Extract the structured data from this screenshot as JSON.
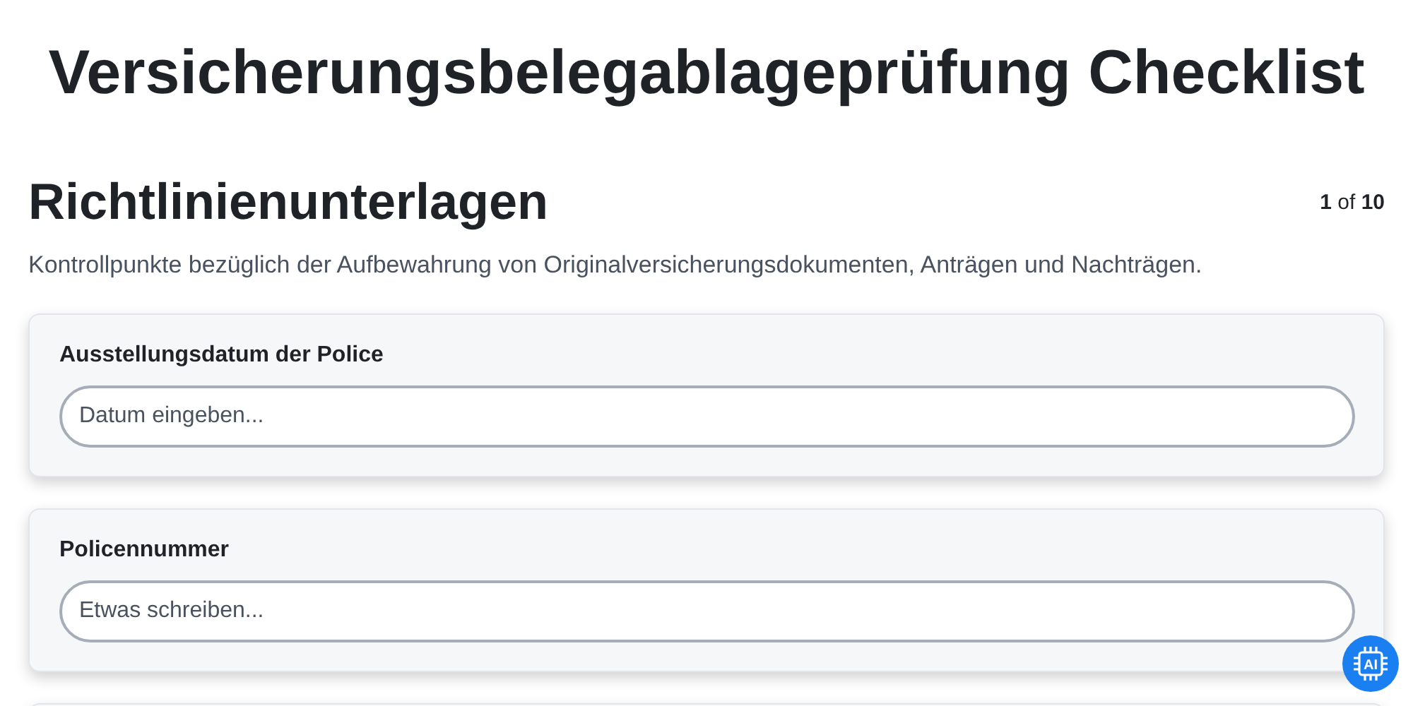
{
  "title": "Versicherungsbelegablageprüfung Checklist",
  "section": {
    "heading": "Richtlinienunterlagen",
    "page_current": "1",
    "page_of": "of",
    "page_total": "10",
    "description": "Kontrollpunkte bezüglich der Aufbewahrung von Originalversicherungsdokumenten, Anträgen und Nachträgen."
  },
  "fields": [
    {
      "label": "Ausstellungsdatum der Police",
      "placeholder": "Datum eingeben..."
    },
    {
      "label": "Policennummer",
      "placeholder": "Etwas schreiben..."
    }
  ],
  "assistant_button": {
    "label": "AI"
  }
}
